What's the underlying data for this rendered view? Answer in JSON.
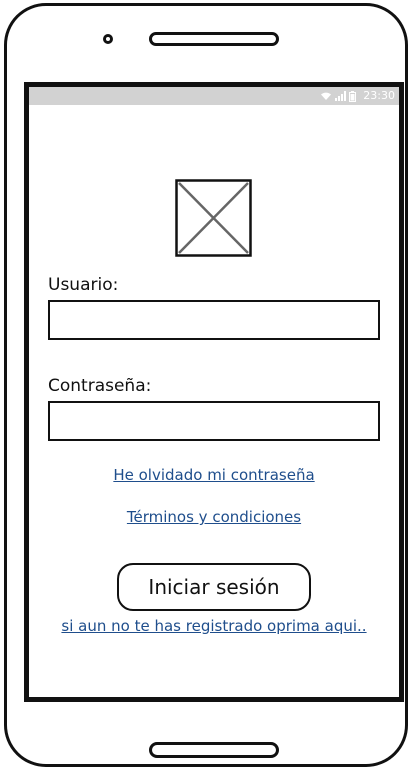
{
  "status_bar": {
    "time": "23:30",
    "icons": [
      "wifi-icon",
      "signal-icon",
      "battery-icon"
    ]
  },
  "logo": {
    "icon": "image-placeholder-icon"
  },
  "login_form": {
    "username_label": "Usuario:",
    "username_value": "",
    "password_label": "Contraseña:",
    "password_value": "",
    "forgot_password_link": "He olvidado mi contraseña",
    "terms_link": "Términos y condiciones",
    "login_button": "Iniciar sesión",
    "register_link": "si aun no te has registrado oprima aqui.."
  },
  "colors": {
    "link": "#1f4e8c",
    "status_bar": "#d2d2d2",
    "outline": "#111111"
  }
}
